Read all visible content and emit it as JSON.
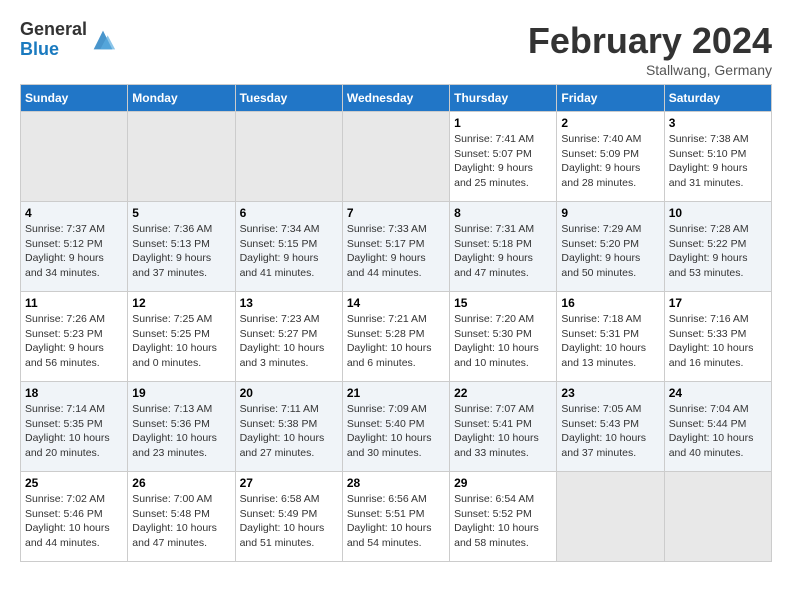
{
  "header": {
    "logo_general": "General",
    "logo_blue": "Blue",
    "month_title": "February 2024",
    "location": "Stallwang, Germany"
  },
  "days_of_week": [
    "Sunday",
    "Monday",
    "Tuesday",
    "Wednesday",
    "Thursday",
    "Friday",
    "Saturday"
  ],
  "weeks": [
    [
      {
        "num": "",
        "info": ""
      },
      {
        "num": "",
        "info": ""
      },
      {
        "num": "",
        "info": ""
      },
      {
        "num": "",
        "info": ""
      },
      {
        "num": "1",
        "info": "Sunrise: 7:41 AM\nSunset: 5:07 PM\nDaylight: 9 hours and 25 minutes."
      },
      {
        "num": "2",
        "info": "Sunrise: 7:40 AM\nSunset: 5:09 PM\nDaylight: 9 hours and 28 minutes."
      },
      {
        "num": "3",
        "info": "Sunrise: 7:38 AM\nSunset: 5:10 PM\nDaylight: 9 hours and 31 minutes."
      }
    ],
    [
      {
        "num": "4",
        "info": "Sunrise: 7:37 AM\nSunset: 5:12 PM\nDaylight: 9 hours and 34 minutes."
      },
      {
        "num": "5",
        "info": "Sunrise: 7:36 AM\nSunset: 5:13 PM\nDaylight: 9 hours and 37 minutes."
      },
      {
        "num": "6",
        "info": "Sunrise: 7:34 AM\nSunset: 5:15 PM\nDaylight: 9 hours and 41 minutes."
      },
      {
        "num": "7",
        "info": "Sunrise: 7:33 AM\nSunset: 5:17 PM\nDaylight: 9 hours and 44 minutes."
      },
      {
        "num": "8",
        "info": "Sunrise: 7:31 AM\nSunset: 5:18 PM\nDaylight: 9 hours and 47 minutes."
      },
      {
        "num": "9",
        "info": "Sunrise: 7:29 AM\nSunset: 5:20 PM\nDaylight: 9 hours and 50 minutes."
      },
      {
        "num": "10",
        "info": "Sunrise: 7:28 AM\nSunset: 5:22 PM\nDaylight: 9 hours and 53 minutes."
      }
    ],
    [
      {
        "num": "11",
        "info": "Sunrise: 7:26 AM\nSunset: 5:23 PM\nDaylight: 9 hours and 56 minutes."
      },
      {
        "num": "12",
        "info": "Sunrise: 7:25 AM\nSunset: 5:25 PM\nDaylight: 10 hours and 0 minutes."
      },
      {
        "num": "13",
        "info": "Sunrise: 7:23 AM\nSunset: 5:27 PM\nDaylight: 10 hours and 3 minutes."
      },
      {
        "num": "14",
        "info": "Sunrise: 7:21 AM\nSunset: 5:28 PM\nDaylight: 10 hours and 6 minutes."
      },
      {
        "num": "15",
        "info": "Sunrise: 7:20 AM\nSunset: 5:30 PM\nDaylight: 10 hours and 10 minutes."
      },
      {
        "num": "16",
        "info": "Sunrise: 7:18 AM\nSunset: 5:31 PM\nDaylight: 10 hours and 13 minutes."
      },
      {
        "num": "17",
        "info": "Sunrise: 7:16 AM\nSunset: 5:33 PM\nDaylight: 10 hours and 16 minutes."
      }
    ],
    [
      {
        "num": "18",
        "info": "Sunrise: 7:14 AM\nSunset: 5:35 PM\nDaylight: 10 hours and 20 minutes."
      },
      {
        "num": "19",
        "info": "Sunrise: 7:13 AM\nSunset: 5:36 PM\nDaylight: 10 hours and 23 minutes."
      },
      {
        "num": "20",
        "info": "Sunrise: 7:11 AM\nSunset: 5:38 PM\nDaylight: 10 hours and 27 minutes."
      },
      {
        "num": "21",
        "info": "Sunrise: 7:09 AM\nSunset: 5:40 PM\nDaylight: 10 hours and 30 minutes."
      },
      {
        "num": "22",
        "info": "Sunrise: 7:07 AM\nSunset: 5:41 PM\nDaylight: 10 hours and 33 minutes."
      },
      {
        "num": "23",
        "info": "Sunrise: 7:05 AM\nSunset: 5:43 PM\nDaylight: 10 hours and 37 minutes."
      },
      {
        "num": "24",
        "info": "Sunrise: 7:04 AM\nSunset: 5:44 PM\nDaylight: 10 hours and 40 minutes."
      }
    ],
    [
      {
        "num": "25",
        "info": "Sunrise: 7:02 AM\nSunset: 5:46 PM\nDaylight: 10 hours and 44 minutes."
      },
      {
        "num": "26",
        "info": "Sunrise: 7:00 AM\nSunset: 5:48 PM\nDaylight: 10 hours and 47 minutes."
      },
      {
        "num": "27",
        "info": "Sunrise: 6:58 AM\nSunset: 5:49 PM\nDaylight: 10 hours and 51 minutes."
      },
      {
        "num": "28",
        "info": "Sunrise: 6:56 AM\nSunset: 5:51 PM\nDaylight: 10 hours and 54 minutes."
      },
      {
        "num": "29",
        "info": "Sunrise: 6:54 AM\nSunset: 5:52 PM\nDaylight: 10 hours and 58 minutes."
      },
      {
        "num": "",
        "info": ""
      },
      {
        "num": "",
        "info": ""
      }
    ]
  ]
}
